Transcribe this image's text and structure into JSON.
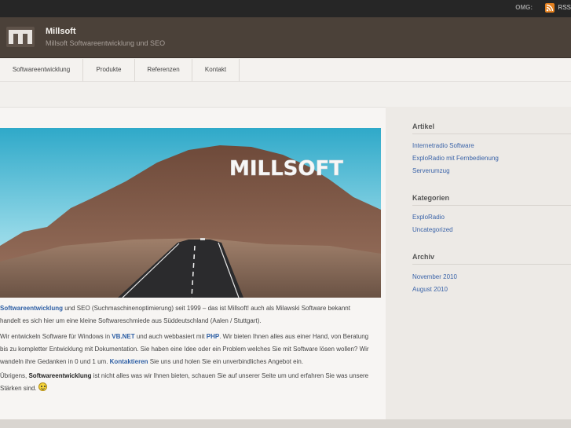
{
  "topbar": {
    "omg_label": "OMG:",
    "rss_label": "RSS",
    "rss_icon": "rss-icon"
  },
  "header": {
    "title": "Millsoft",
    "tagline": "Millsoft Softwareentwicklung und SEO",
    "logo_icon": "millsoft-logo-icon"
  },
  "nav": {
    "items": [
      {
        "label": "Softwareentwicklung"
      },
      {
        "label": "Produkte"
      },
      {
        "label": "Referenzen"
      },
      {
        "label": "Kontakt"
      }
    ]
  },
  "hero": {
    "sign_text": "MILLSOFT"
  },
  "content": {
    "p1": {
      "link": "Softwareentwicklung",
      "text": " und SEO (Suchmaschinenoptimierung) seit 1999 – das ist Millsoft! auch als Milawski Software bekannt handelt es sich hier um eine kleine Softwareschmiede aus Süddeutschland (Aalen / Stuttgart)."
    },
    "p2": {
      "t1": "Wir entwickeln Software für Windows in ",
      "l1": "VB.NET",
      "t2": " und auch webbasiert mit ",
      "l2": "PHP",
      "t3": ". Wir bieten Ihnen alles aus einer Hand, von Beratung bis zu kompletter Entwicklung mit Dokumentation. Sie haben eine Idee oder ein Problem welches Sie mit Software lösen wollen? Wir wandeln ihre Gedanken in 0 und 1 um. ",
      "l3": "Kontaktieren",
      "t4": " Sie uns und holen Sie ein unverbindliches Angebot ein."
    },
    "p3": {
      "t1": "Übrigens, ",
      "b1": "Softwareentwicklung",
      "t2": " ist nicht alles was wir Ihnen bieten, schauen Sie auf unserer Seite um und erfahren Sie was unsere Stärken sind. "
    }
  },
  "sidebar": {
    "articles": {
      "title": "Artikel",
      "links": [
        "Internetradio Software",
        "ExploRadio mit Fernbedienung",
        "Serverumzug"
      ]
    },
    "categories": {
      "title": "Kategorien",
      "links": [
        "ExploRadio",
        "Uncategorized"
      ]
    },
    "archive": {
      "title": "Archiv",
      "links": [
        "November 2010",
        "August 2010"
      ]
    }
  }
}
